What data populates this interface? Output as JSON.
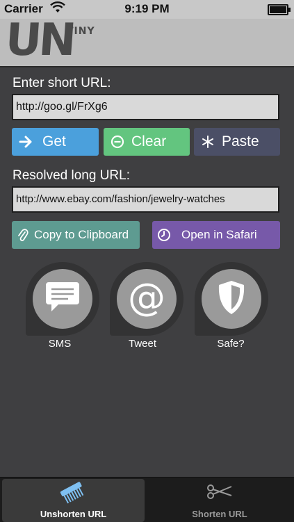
{
  "status_bar": {
    "carrier": "Carrier",
    "time": "9:19 PM"
  },
  "header": {
    "logo_main": "UN",
    "logo_small": "TINY"
  },
  "short_url": {
    "label": "Enter short URL:",
    "value": "http://goo.gl/FrXg6"
  },
  "actions": {
    "get": "Get",
    "clear": "Clear",
    "paste": "Paste"
  },
  "long_url": {
    "label": "Resolved long URL:",
    "value": "http://www.ebay.com/fashion/jewelry-watches"
  },
  "buttons": {
    "copy": "Copy to Clipboard",
    "safari": "Open in Safari"
  },
  "share": {
    "sms": "SMS",
    "tweet": "Tweet",
    "safe": "Safe?"
  },
  "tabs": {
    "unshorten": "Unshorten URL",
    "shorten": "Shorten URL"
  },
  "colors": {
    "get": "#4ba0dc",
    "clear": "#63c57f",
    "paste": "#4b4f66",
    "copy": "#5e9b91",
    "safari": "#7759a9",
    "background": "#3f3f41"
  },
  "icons": {
    "get": "arrow-right-icon",
    "clear": "minus-circle-icon",
    "paste": "snowflake-icon",
    "copy": "paperclip-icon",
    "safari": "clock-icon",
    "sms": "speech-bubble-icon",
    "tweet": "at-sign-icon",
    "safe": "shield-icon",
    "unshorten": "comb-icon",
    "shorten": "scissors-icon"
  }
}
